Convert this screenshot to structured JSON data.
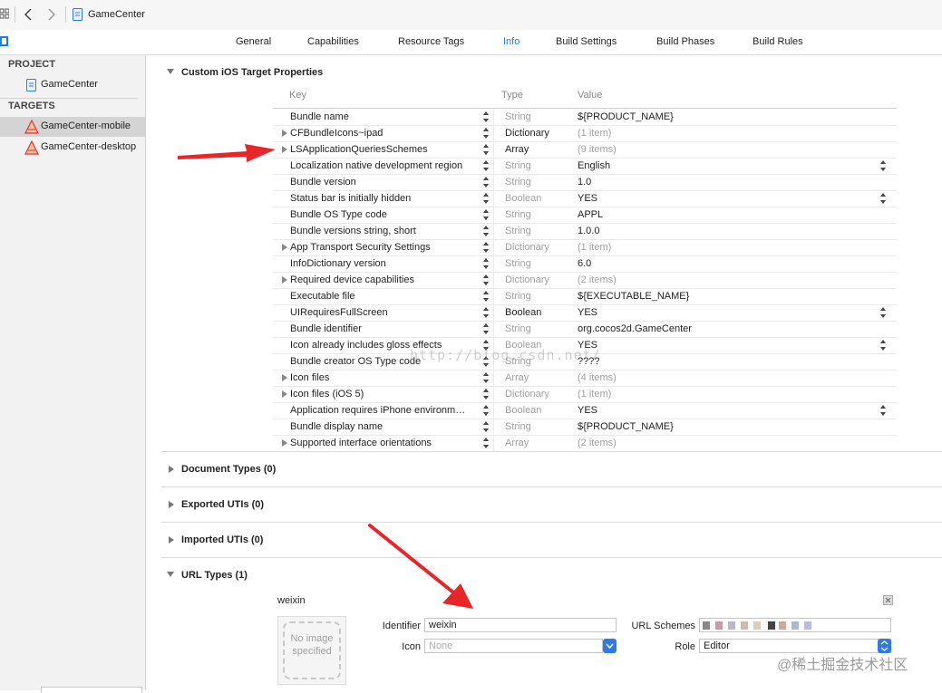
{
  "window": {
    "title": "GameCenter"
  },
  "tabs": [
    {
      "label": "General"
    },
    {
      "label": "Capabilities"
    },
    {
      "label": "Resource Tags"
    },
    {
      "label": "Info",
      "active": true
    },
    {
      "label": "Build Settings"
    },
    {
      "label": "Build Phases"
    },
    {
      "label": "Build Rules"
    }
  ],
  "sidebar": {
    "project_header": "PROJECT",
    "project_item": "GameCenter",
    "targets_header": "TARGETS",
    "targets": [
      {
        "label": "GameCenter-mobile",
        "selected": true
      },
      {
        "label": "GameCenter-desktop",
        "selected": false
      }
    ]
  },
  "custom_props": {
    "title": "Custom iOS Target Properties",
    "headers": {
      "key": "Key",
      "type": "Type",
      "value": "Value"
    },
    "rows": [
      {
        "key": "Bundle name",
        "type": "String",
        "value": "${PRODUCT_NAME}",
        "disclosure": false,
        "dim": true,
        "value_stepper": false
      },
      {
        "key": "CFBundleIcons~ipad",
        "type": "Dictionary",
        "value": "(1 item)",
        "disclosure": true,
        "dim": false,
        "value_stepper": false
      },
      {
        "key": "LSApplicationQueriesSchemes",
        "type": "Array",
        "value": "(9 items)",
        "disclosure": true,
        "dim": false,
        "value_stepper": false
      },
      {
        "key": "Localization native development region",
        "type": "String",
        "value": "English",
        "disclosure": false,
        "dim": true,
        "value_stepper": true
      },
      {
        "key": "Bundle version",
        "type": "String",
        "value": "1.0",
        "disclosure": false,
        "dim": true,
        "value_stepper": false
      },
      {
        "key": "Status bar is initially hidden",
        "type": "Boolean",
        "value": "YES",
        "disclosure": false,
        "dim": true,
        "value_stepper": true
      },
      {
        "key": "Bundle OS Type code",
        "type": "String",
        "value": "APPL",
        "disclosure": false,
        "dim": true,
        "value_stepper": false
      },
      {
        "key": "Bundle versions string, short",
        "type": "String",
        "value": "1.0.0",
        "disclosure": false,
        "dim": true,
        "value_stepper": false
      },
      {
        "key": "App Transport Security Settings",
        "type": "Dictionary",
        "value": "(1 item)",
        "disclosure": true,
        "dim": true,
        "value_stepper": false
      },
      {
        "key": "InfoDictionary version",
        "type": "String",
        "value": "6.0",
        "disclosure": false,
        "dim": true,
        "value_stepper": false
      },
      {
        "key": "Required device capabilities",
        "type": "Dictionary",
        "value": "(2 items)",
        "disclosure": true,
        "dim": true,
        "value_stepper": false
      },
      {
        "key": "Executable file",
        "type": "String",
        "value": "${EXECUTABLE_NAME}",
        "disclosure": false,
        "dim": true,
        "value_stepper": false
      },
      {
        "key": "UIRequiresFullScreen",
        "type": "Boolean",
        "value": "YES",
        "disclosure": false,
        "dim": false,
        "value_stepper": true
      },
      {
        "key": "Bundle identifier",
        "type": "String",
        "value": "org.cocos2d.GameCenter",
        "disclosure": false,
        "dim": true,
        "value_stepper": false
      },
      {
        "key": "Icon already includes gloss effects",
        "type": "Boolean",
        "value": "YES",
        "disclosure": false,
        "dim": true,
        "value_stepper": true
      },
      {
        "key": "Bundle creator OS Type code",
        "type": "String",
        "value": "????",
        "disclosure": false,
        "dim": true,
        "value_stepper": false
      },
      {
        "key": "Icon files",
        "type": "Array",
        "value": "(4 items)",
        "disclosure": true,
        "dim": true,
        "value_stepper": false
      },
      {
        "key": "Icon files (iOS 5)",
        "type": "Dictionary",
        "value": "(1 item)",
        "disclosure": true,
        "dim": true,
        "value_stepper": false
      },
      {
        "key": "Application requires iPhone environm…",
        "type": "Boolean",
        "value": "YES",
        "disclosure": false,
        "dim": true,
        "value_stepper": true
      },
      {
        "key": "Bundle display name",
        "type": "String",
        "value": "${PRODUCT_NAME}",
        "disclosure": false,
        "dim": true,
        "value_stepper": false
      },
      {
        "key": "Supported interface orientations",
        "type": "Array",
        "value": "(2 items)",
        "disclosure": true,
        "dim": true,
        "value_stepper": false
      }
    ]
  },
  "sections": {
    "document_types": "Document Types (0)",
    "exported_utis": "Exported UTIs (0)",
    "imported_utis": "Imported UTIs (0)",
    "url_types": "URL Types (1)"
  },
  "url_type": {
    "name": "weixin",
    "image_placeholder": "No image specified",
    "identifier_label": "Identifier",
    "identifier_value": "weixin",
    "icon_label": "Icon",
    "icon_placeholder": "None",
    "url_schemes_label": "URL Schemes",
    "role_label": "Role",
    "role_value": "Editor"
  },
  "watermarks": {
    "center": "http://blog.csdn.net/",
    "bottom_right": "@稀土掘金技术社区"
  },
  "colors": {
    "accent": "#1a7cf0",
    "arrow": "#e8262a"
  }
}
